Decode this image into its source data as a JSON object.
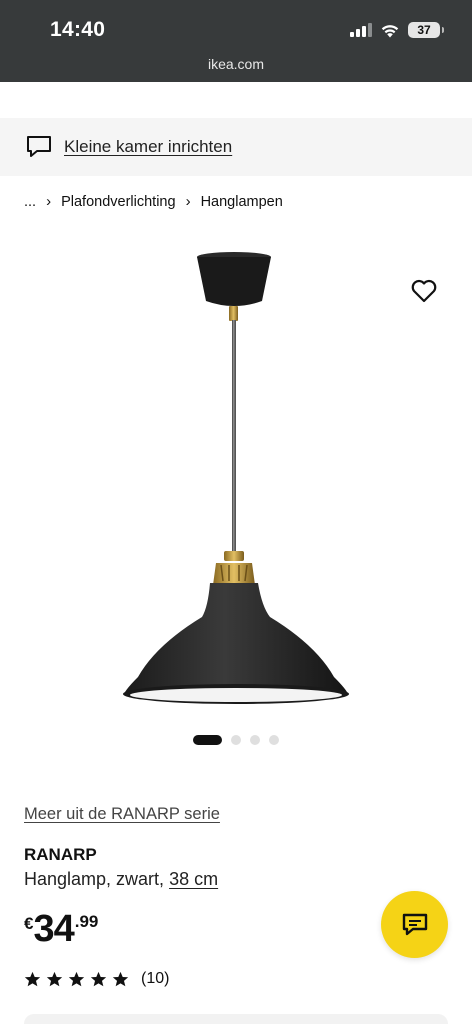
{
  "status_bar": {
    "time": "14:40",
    "battery": "37",
    "url": "ikea.com",
    "background": "#373a3b"
  },
  "banner": {
    "icon": "chat-bubble-outline-icon",
    "link": "Kleine kamer inrichten"
  },
  "breadcrumb": {
    "ellipsis": "...",
    "items": [
      "Plafondverlichting",
      "Hanglampen"
    ]
  },
  "gallery": {
    "image": "black-pendant-lamp-image",
    "slide_count": 4,
    "active_slide": 1
  },
  "product": {
    "series_link": "Meer uit de RANARP serie",
    "name": "RANARP",
    "description": "Hanglamp, zwart,",
    "size_link": "38 cm",
    "price": {
      "currency": "€",
      "integer": "34",
      "decimal": ".99"
    },
    "rating": {
      "stars": 5,
      "reviews": "(10)"
    }
  },
  "colors": {
    "accent": "#f5d316",
    "text": "#111111",
    "banner_bg": "#f5f5f5"
  }
}
